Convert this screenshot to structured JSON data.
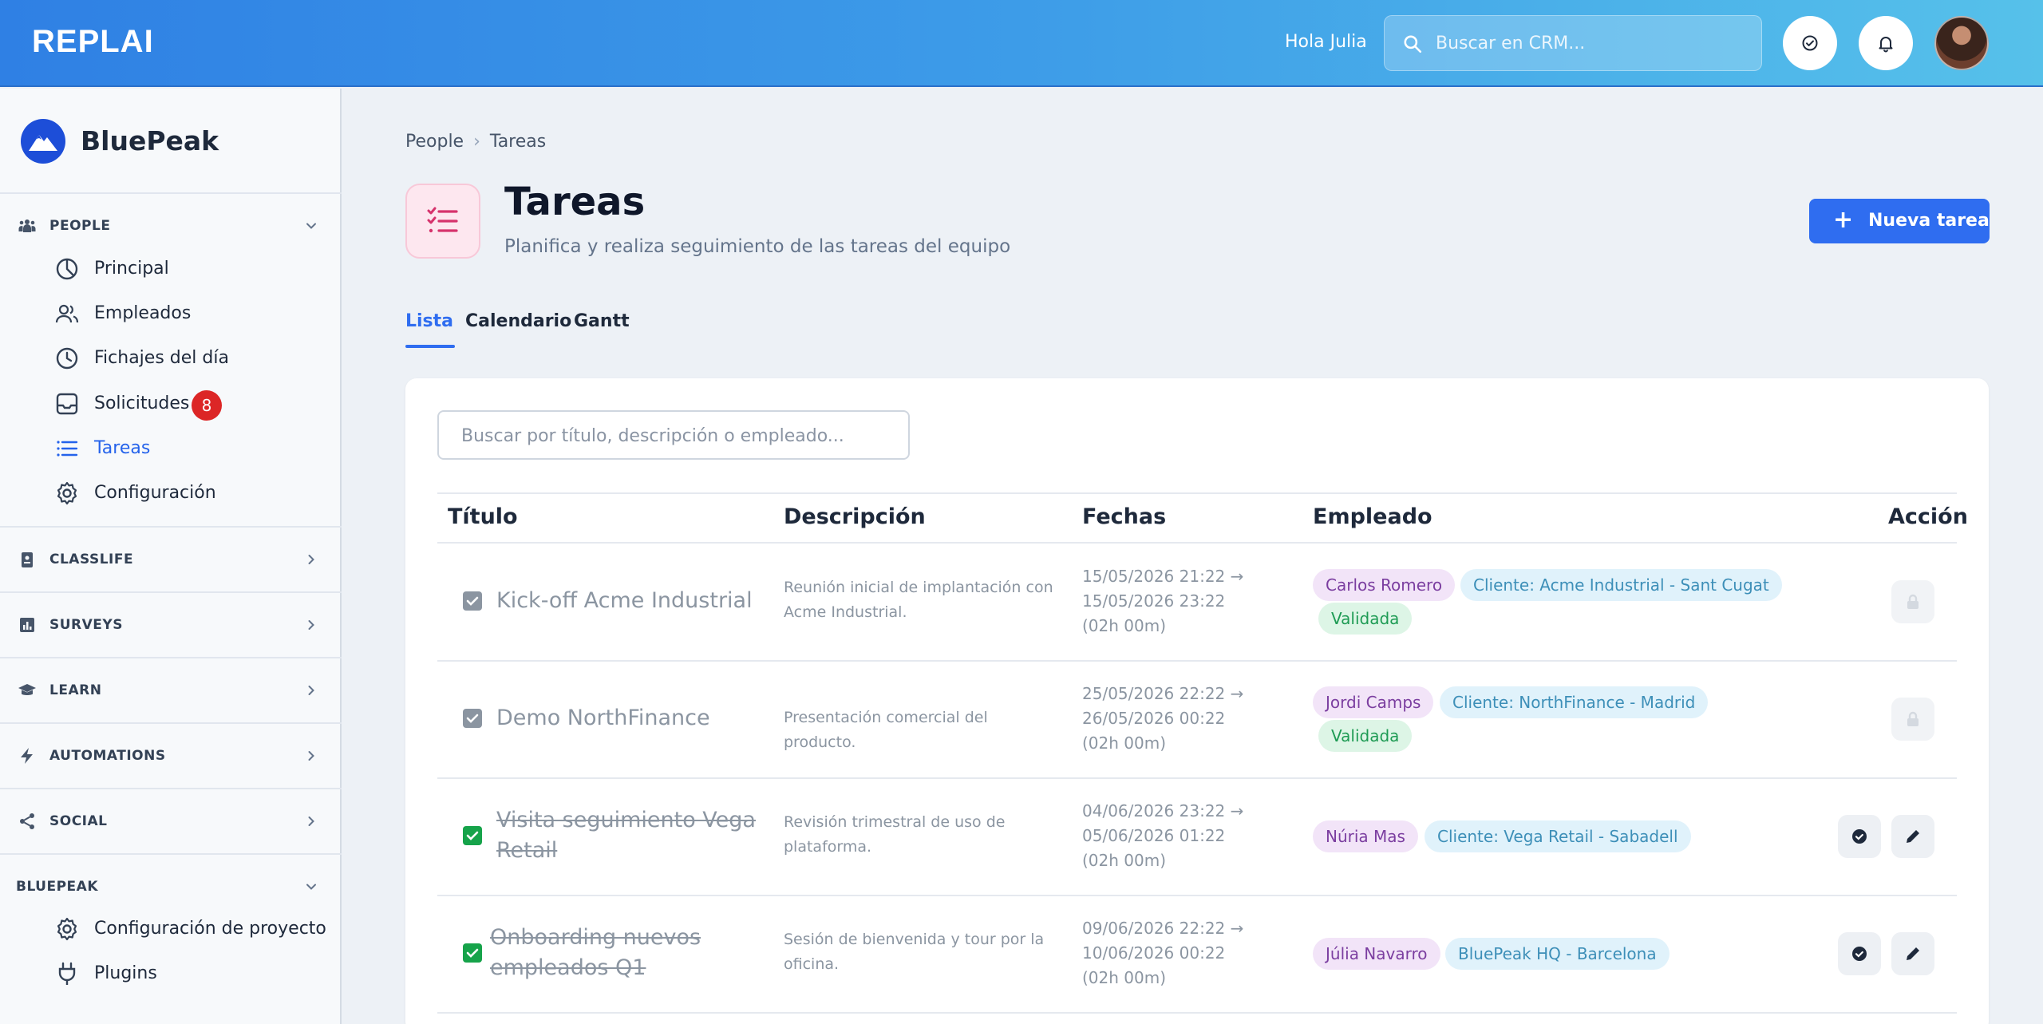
{
  "topbar": {
    "logo": "REPLAI",
    "greeting": "Hola Julia",
    "search_placeholder": "Buscar en CRM..."
  },
  "sidebar": {
    "brand": "BluePeak",
    "sections": [
      {
        "label": "PEOPLE",
        "icon": "people-icon",
        "expanded": true
      },
      {
        "label": "CLASSLIFE",
        "icon": "id-badge-icon",
        "expanded": false
      },
      {
        "label": "SURVEYS",
        "icon": "bar-chart-icon",
        "expanded": false
      },
      {
        "label": "LEARN",
        "icon": "graduation-cap-icon",
        "expanded": false
      },
      {
        "label": "AUTOMATIONS",
        "icon": "lightning-icon",
        "expanded": false
      },
      {
        "label": "SOCIAL",
        "icon": "share-icon",
        "expanded": false
      },
      {
        "label": "BLUEPEAK",
        "expanded": true
      }
    ],
    "people_items": [
      {
        "label": "Principal",
        "icon": "pie-chart-icon"
      },
      {
        "label": "Empleados",
        "icon": "users-icon"
      },
      {
        "label": "Fichajes del día",
        "icon": "clock-icon"
      },
      {
        "label": "Solicitudes",
        "icon": "inbox-icon",
        "badge": "8"
      },
      {
        "label": "Tareas",
        "icon": "list-icon",
        "active": true
      },
      {
        "label": "Configuración",
        "icon": "gear-icon"
      }
    ],
    "bluepeak_items": [
      {
        "label": "Configuración de proyecto",
        "icon": "gear-icon"
      },
      {
        "label": "Plugins",
        "icon": "plug-icon"
      }
    ]
  },
  "breadcrumb": [
    "People",
    "Tareas"
  ],
  "page": {
    "title": "Tareas",
    "subtitle": "Planifica y realiza seguimiento de las tareas del equipo",
    "new_button": "Nueva tarea"
  },
  "tabs": [
    "Lista",
    "Calendario",
    "Gantt"
  ],
  "table": {
    "search_placeholder": "Buscar por título, descripción o empleado...",
    "headers": [
      "Título",
      "Descripción",
      "Fechas",
      "Empleado",
      "Acción"
    ],
    "rows": [
      {
        "title_lines": [
          "Kick-off Acme Industrial"
        ],
        "done": false,
        "status_check": "grey",
        "desc_lines": [
          "Reunión inicial de implantación con",
          "Acme Industrial."
        ],
        "date_lines": [
          "15/05/2026 21:22 →",
          "15/05/2026 23:22",
          "(02h 00m)"
        ],
        "employee": "Carlos Romero",
        "client": "Cliente: Acme Industrial - Sant Cugat",
        "status": "Validada",
        "locked": true
      },
      {
        "title_lines": [
          "Demo NorthFinance"
        ],
        "done": false,
        "status_check": "grey",
        "desc_lines": [
          "Presentación comercial del producto."
        ],
        "date_lines": [
          "25/05/2026 22:22 →",
          "26/05/2026 00:22",
          "(02h 00m)"
        ],
        "employee": "Jordi Camps",
        "client": "Cliente: NorthFinance - Madrid",
        "status": "Validada",
        "locked": true
      },
      {
        "title_lines": [
          "Visita seguimiento Vega",
          "Retail"
        ],
        "done": true,
        "status_check": "green",
        "desc_lines": [
          "Revisión trimestral de uso de",
          "plataforma."
        ],
        "date_lines": [
          "04/06/2026 23:22 →",
          "05/06/2026 01:22",
          "(02h 00m)"
        ],
        "employee": "Núria Mas",
        "client": "Cliente: Vega Retail - Sabadell",
        "locked": false
      },
      {
        "title_lines": [
          "Onboarding nuevos",
          "empleados Q1"
        ],
        "done": true,
        "status_check": "green",
        "desc_lines": [
          "Sesión de bienvenida y tour por la",
          "oficina."
        ],
        "date_lines": [
          "09/06/2026 22:22 →",
          "10/06/2026 00:22",
          "(02h 00m)"
        ],
        "employee": "Júlia Navarro",
        "client": "BluePeak HQ - Barcelona",
        "locked": false
      }
    ]
  },
  "colors": {
    "accent": "#2f6df0",
    "badge": "#dc2626",
    "done": "#16a34a"
  }
}
